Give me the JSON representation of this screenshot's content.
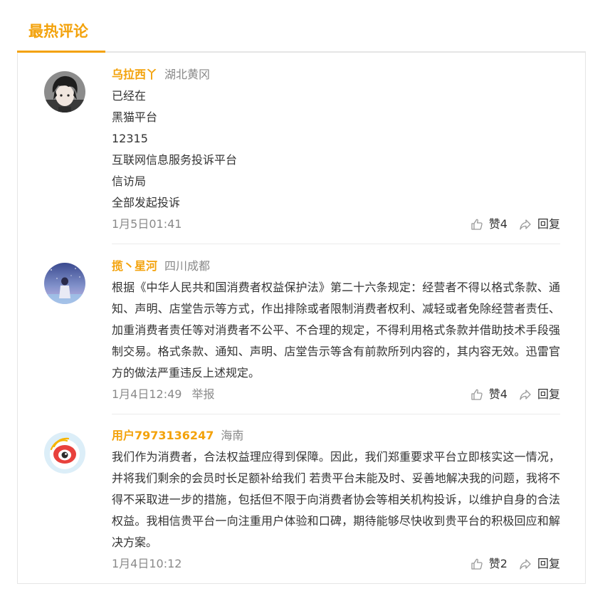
{
  "section": {
    "title": "最热评论",
    "accent_color": "#f3a20b"
  },
  "comments": [
    {
      "username": "乌拉西丫",
      "location": "湖北黄冈",
      "avatar_icon": "dark-haired-boy-avatar",
      "lines": [
        "已经在",
        "黑猫平台",
        "12315",
        "互联网信息服务投诉平台",
        "信访局",
        "全部发起投诉"
      ],
      "time": "1月5日01:41",
      "report": "",
      "like_label": "赞4",
      "reply_label": "回复"
    },
    {
      "username": "揽丶星河",
      "location": "四川成都",
      "avatar_icon": "starry-sky-avatar",
      "text": "根据《中华人民共和国消费者权益保护法》第二十六条规定：经营者不得以格式条款、通知、声明、店堂告示等方式，作出排除或者限制消费者权利、减轻或者免除经营者责任、加重消费者责任等对消费者不公平、不合理的规定，不得利用格式条款并借助技术手段强制交易。格式条款、通知、声明、店堂告示等含有前款所列内容的，其内容无效。迅雷官方的做法严重违反上述规定。",
      "time": "1月4日12:49",
      "report": "举报",
      "like_label": "赞4",
      "reply_label": "回复"
    },
    {
      "username": "用户7973136247",
      "location": "海南",
      "avatar_icon": "weibo-default-avatar",
      "text": "我们作为消费者，合法权益理应得到保障。因此，我们郑重要求平台立即核实这一情况，并将我们剩余的会员时长足额补给我们 若贵平台未能及时、妥善地解决我的问题，我将不得不采取进一步的措施，包括但不限于向消费者协会等相关机构投诉，以维护自身的合法权益。我相信贵平台一向注重用户体验和口碑，期待能够尽快收到贵平台的积极回应和解决方案。",
      "time": "1月4日10:12",
      "report": "",
      "like_label": "赞2",
      "reply_label": "回复"
    }
  ]
}
